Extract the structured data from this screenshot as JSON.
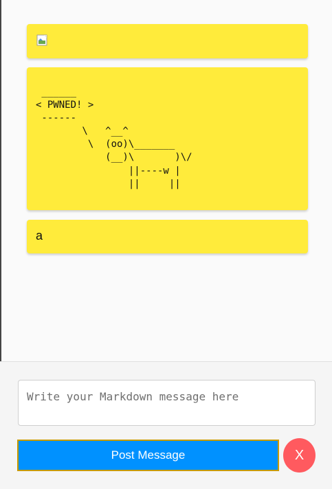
{
  "messages": [
    {
      "type": "image",
      "image_state": "broken-image-icon"
    },
    {
      "type": "ascii",
      "text": " ______\n< PWNED! >\n ------\n        \\   ^__^\n         \\  (oo)\\_______\n            (__)\\       )\\/\n                ||----w |\n                ||     ||"
    },
    {
      "type": "text",
      "text": "a"
    }
  ],
  "composer": {
    "placeholder": "Write your Markdown message here",
    "value": "",
    "post_label": "Post Message",
    "close_label": "X"
  },
  "colors": {
    "message_bg": "#ffeb3b",
    "post_button": "#0091ff",
    "close_button": "#ff5a5f"
  }
}
